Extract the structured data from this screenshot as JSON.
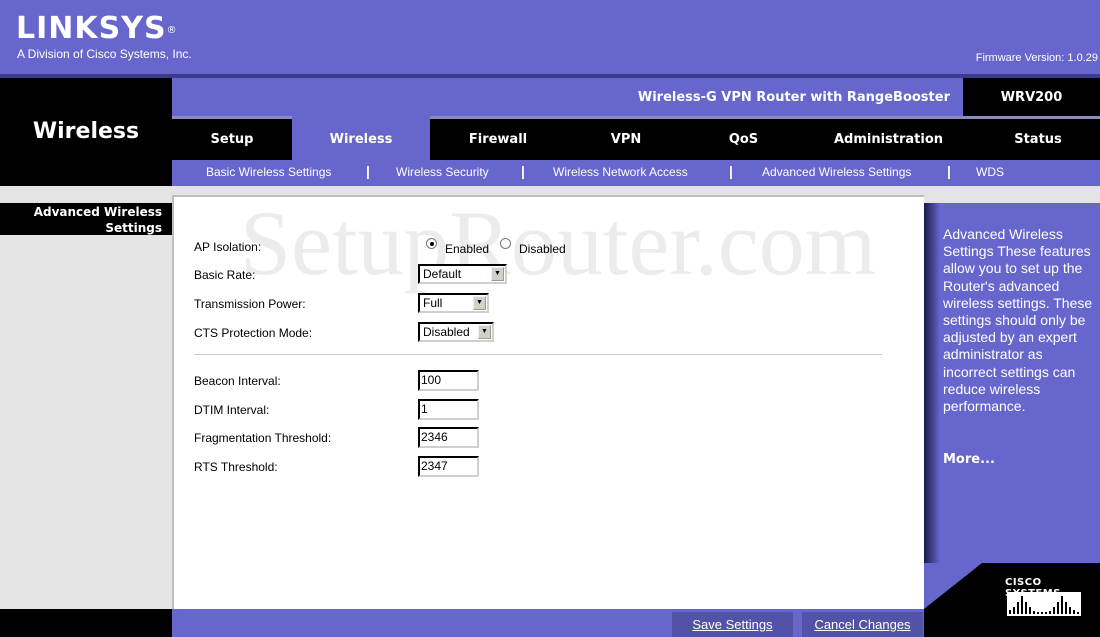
{
  "header": {
    "brand": "LINKSYS",
    "brand_mark": "®",
    "tagline": "A Division of Cisco Systems, Inc.",
    "firmware": "Firmware Version: 1.0.29",
    "product_name": "Wireless-G VPN Router with RangeBooster",
    "model": "WRV200",
    "section_title": "Wireless"
  },
  "tabs": [
    {
      "label": "Setup",
      "active": false
    },
    {
      "label": "Wireless",
      "active": true
    },
    {
      "label": "Firewall",
      "active": false
    },
    {
      "label": "VPN",
      "active": false
    },
    {
      "label": "QoS",
      "active": false
    },
    {
      "label": "Administration",
      "active": false
    },
    {
      "label": "Status",
      "active": false
    }
  ],
  "subnav": [
    {
      "label": "Basic Wireless Settings"
    },
    {
      "label": "Wireless Security"
    },
    {
      "label": "Wireless Network Access"
    },
    {
      "label": "Advanced Wireless Settings",
      "active": true
    },
    {
      "label": "WDS"
    }
  ],
  "subnav_separator": "|",
  "sidebar": {
    "label_line1": "Advanced Wireless",
    "label_line2": "Settings"
  },
  "watermark": "SetupRouter.com",
  "form": {
    "ap_isolation": {
      "label": "AP Isolation:",
      "options": [
        "Enabled",
        "Disabled"
      ],
      "selected": "Enabled"
    },
    "basic_rate": {
      "label": "Basic Rate:",
      "value": "Default"
    },
    "transmission_power": {
      "label": "Transmission Power:",
      "value": "Full"
    },
    "cts_protection_mode": {
      "label": "CTS Protection Mode:",
      "value": "Disabled"
    },
    "beacon_interval": {
      "label": "Beacon Interval:",
      "value": "100"
    },
    "dtim_interval": {
      "label": "DTIM Interval:",
      "value": "1"
    },
    "fragmentation_threshold": {
      "label": "Fragmentation Threshold:",
      "value": "2346"
    },
    "rts_threshold": {
      "label": "RTS Threshold:",
      "value": "2347"
    }
  },
  "help": {
    "text": "Advanced Wireless Settings These features allow you to set up the Router's advanced wireless settings. These settings should only be adjusted by an expert administrator as incorrect settings can reduce wireless performance.",
    "more": "More..."
  },
  "buttons": {
    "save": "Save Settings",
    "cancel": "Cancel Changes"
  },
  "footer_logo": "CISCO SYSTEMS"
}
